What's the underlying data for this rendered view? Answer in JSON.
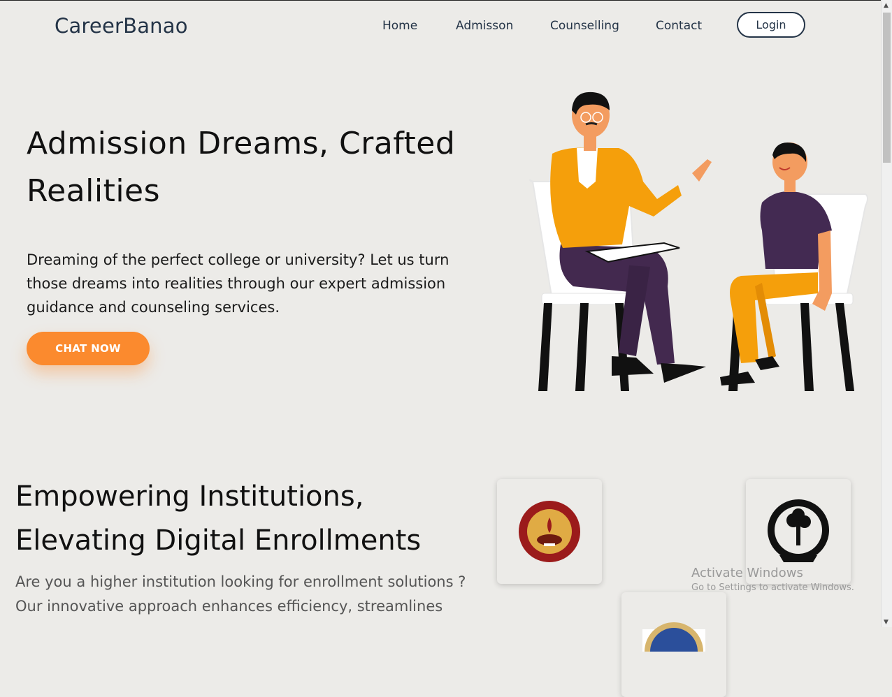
{
  "nav": {
    "brand": "CareerBanao",
    "links": [
      "Home",
      "Admisson",
      "Counselling",
      "Contact"
    ],
    "login": "Login"
  },
  "hero": {
    "title": "Admission Dreams, Crafted Realities",
    "text": "Dreaming of the perfect college or university? Let us turn those dreams into realities through our expert admission guidance and counseling services.",
    "cta": "CHAT NOW"
  },
  "section2": {
    "title_line1": "Empowering Institutions,",
    "title_line2": "Elevating Digital Enrollments",
    "text_line1": "Are you a higher institution looking for enrollment solutions ?",
    "text_line2": "Our innovative approach enhances efficiency, streamlines"
  },
  "overlay": {
    "activate_title": "Activate Windows",
    "activate_sub": "Go to Settings to activate Windows."
  },
  "colors": {
    "accent": "#fb8a2e",
    "navy": "#243447",
    "bg": "#ecebe8"
  }
}
